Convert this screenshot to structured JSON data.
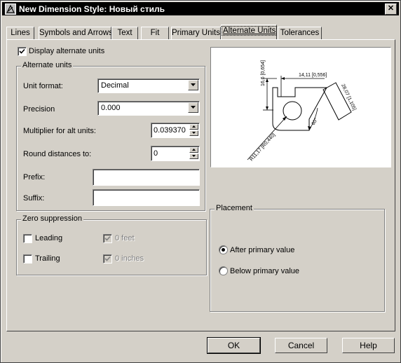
{
  "window": {
    "title": "New Dimension Style: Новый стиль",
    "close_glyph": "✕"
  },
  "tabs": [
    {
      "label": "Lines"
    },
    {
      "label": "Symbols and Arrows"
    },
    {
      "label": "Text"
    },
    {
      "label": "Fit"
    },
    {
      "label": "Primary Units"
    },
    {
      "label": "Alternate Units",
      "active": true
    },
    {
      "label": "Tolerances"
    }
  ],
  "display_alt": {
    "label": "Display alternate units",
    "checked": true
  },
  "alt_units": {
    "title": "Alternate units",
    "unit_format": {
      "label": "Unit format:",
      "value": "Decimal"
    },
    "precision": {
      "label": "Precision",
      "value": "0.000"
    },
    "multiplier": {
      "label": "Multiplier for alt units:",
      "value": "0.039370"
    },
    "round": {
      "label": "Round distances  to:",
      "value": "0"
    },
    "prefix": {
      "label": "Prefix:",
      "value": ""
    },
    "suffix": {
      "label": "Suffix:",
      "value": ""
    }
  },
  "zero": {
    "title": "Zero suppression",
    "leading": {
      "label": "Leading",
      "checked": false
    },
    "trailing": {
      "label": "Trailing",
      "checked": false
    },
    "feet": {
      "label": "0 feet",
      "checked": true,
      "disabled": true
    },
    "inches": {
      "label": "0 inches",
      "checked": true,
      "disabled": true
    }
  },
  "preview": {
    "dim_top": "14,11 [0,556]",
    "dim_left": "16,6 [0,654]",
    "dim_right": "28,07 [1,105]",
    "dim_angle": "60°",
    "dim_radius": "R11,17 [R0,440]"
  },
  "placement": {
    "title": "Placement",
    "after": {
      "label": "After primary value",
      "selected": true
    },
    "below": {
      "label": "Below primary value",
      "selected": false
    }
  },
  "buttons": {
    "ok": "OK",
    "cancel": "Cancel",
    "help": "Help"
  }
}
